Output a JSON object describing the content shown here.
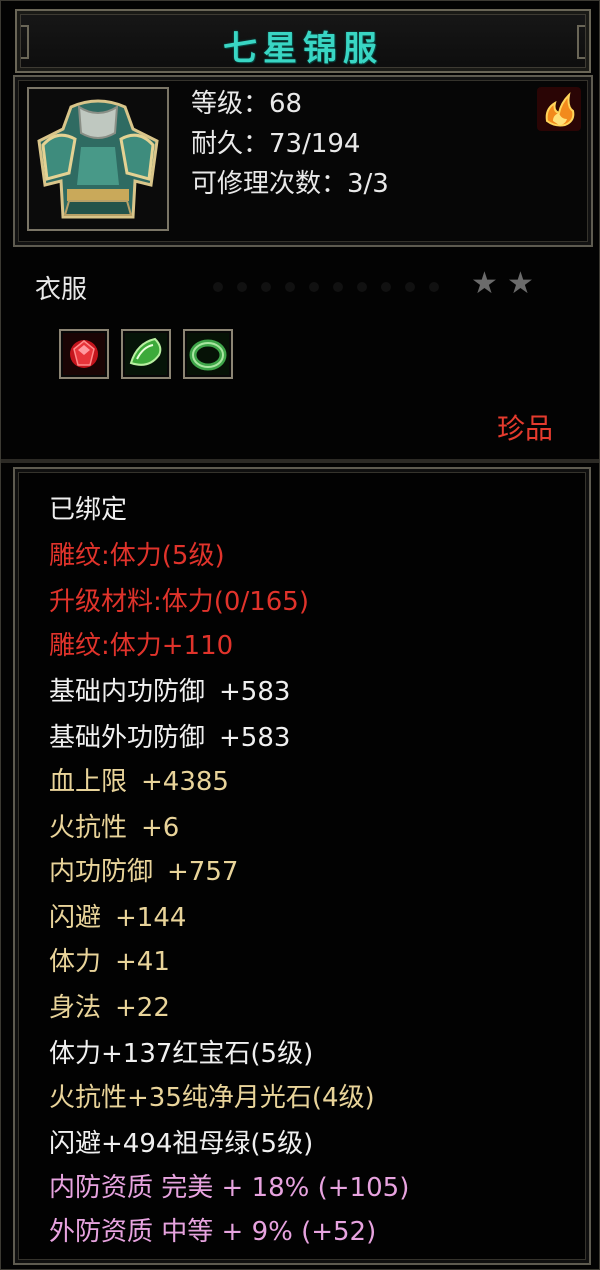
{
  "item": {
    "name": "七星锦服",
    "level_line": "等级：68",
    "durability_line": "耐久：73/194",
    "repair_line": "可修理次数：3/3",
    "type": "衣服",
    "rarity": "珍品"
  },
  "icons": {
    "item": "armor-robe-icon",
    "element": "fire-icon",
    "gems": [
      "ruby-gem-icon",
      "emerald-gem-icon",
      "jade-ring-icon"
    ]
  },
  "stars": [
    "★",
    "★"
  ],
  "properties": [
    {
      "text": "已绑定",
      "color": "white"
    },
    {
      "text": "雕纹:体力(5级)",
      "color": "red"
    },
    {
      "text": "升级材料:体力(0/165)",
      "color": "red"
    },
    {
      "text": "雕纹:体力+110",
      "color": "red"
    },
    {
      "text": "基础内功防御",
      "value": "+583",
      "color": "white"
    },
    {
      "text": "基础外功防御",
      "value": "+583",
      "color": "white"
    },
    {
      "text": "血上限",
      "value": "+4385",
      "color": "gold"
    },
    {
      "text": "火抗性",
      "value": "+6",
      "color": "gold"
    },
    {
      "text": "内功防御",
      "value": "+757",
      "color": "gold"
    },
    {
      "text": "闪避",
      "value": "+144",
      "color": "gold"
    },
    {
      "text": "体力",
      "value": "+41",
      "color": "gold"
    },
    {
      "text": "身法",
      "value": "+22",
      "color": "gold"
    },
    {
      "text": "体力+137红宝石(5级)",
      "color": "white"
    },
    {
      "text": "火抗性+35纯净月光石(4级)",
      "color": "gold"
    },
    {
      "text": "闪避+494祖母绿(5级)",
      "color": "white"
    },
    {
      "text": "内防资质 完美 + 18% (+105)",
      "color": "pink"
    },
    {
      "text": "外防资质 中等 + 9% (+52)",
      "color": "pink"
    }
  ],
  "colors": {
    "title": "#39d6c4",
    "red": "#e0332b",
    "gold": "#e9d49a",
    "pink": "#e7a3df",
    "white": "#f0f0f0",
    "rarity": "#e53b2e"
  }
}
